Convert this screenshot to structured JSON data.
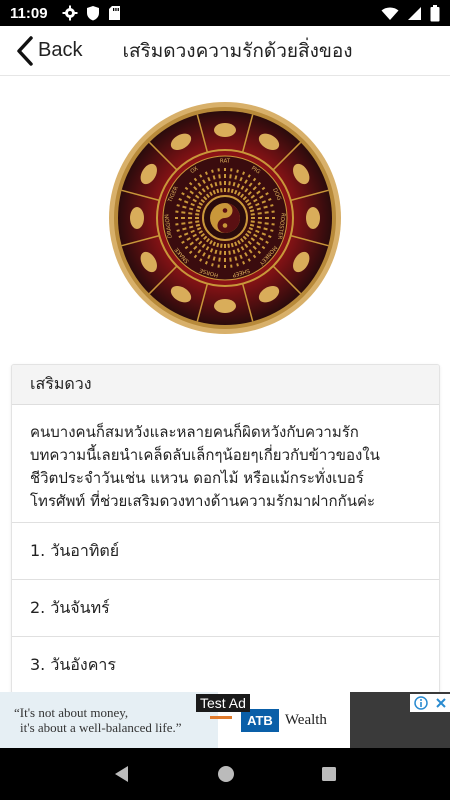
{
  "status": {
    "time": "11:09",
    "left_icons": [
      "gear-icon",
      "shield-icon",
      "sd-card-icon"
    ],
    "right_icons": [
      "wifi-icon",
      "cellular-icon",
      "battery-icon"
    ]
  },
  "appbar": {
    "back_label": "Back",
    "title": "เสริมดวงความรักด้วยสิ่งของ"
  },
  "wheel": {
    "segments": [
      "RAT",
      "PIG",
      "DOG",
      "ROOSTER",
      "MONKEY",
      "SHEEP",
      "HORSE",
      "SNAKE",
      "DRAGON",
      "TIGER",
      "OX"
    ]
  },
  "card": {
    "header": "เสริมดวง",
    "body_lines": [
      "คนบางคนก็สมหวังและหลายคนก็ผิดหวังกับความรัก",
      "บทความนี้เลยนำเคล็ดลับเล็กๆน้อยๆเกี่ยวกับข้าวของใน",
      "ชีวิตประจำวันเช่น แหวน ดอกไม้ หรือแม้กระทั่งเบอร์",
      "โทรศัพท์ ที่ช่วยเสริมดวงทางด้านความรักมาฝากกันค่ะ"
    ],
    "items": [
      "1. วันอาทิตย์",
      "2. วันจันทร์",
      "3. วันอังคาร"
    ]
  },
  "ad": {
    "badge": "Test Ad",
    "quote_line1": "“It's not about money,",
    "quote_line2": "it's about a well-balanced life.”",
    "brand": "ATB",
    "brand_suffix": "Wealth"
  },
  "colors": {
    "wheel_red": "#a3171b",
    "wheel_gold": "#c9973a",
    "wheel_dark": "#2a0b0c"
  }
}
